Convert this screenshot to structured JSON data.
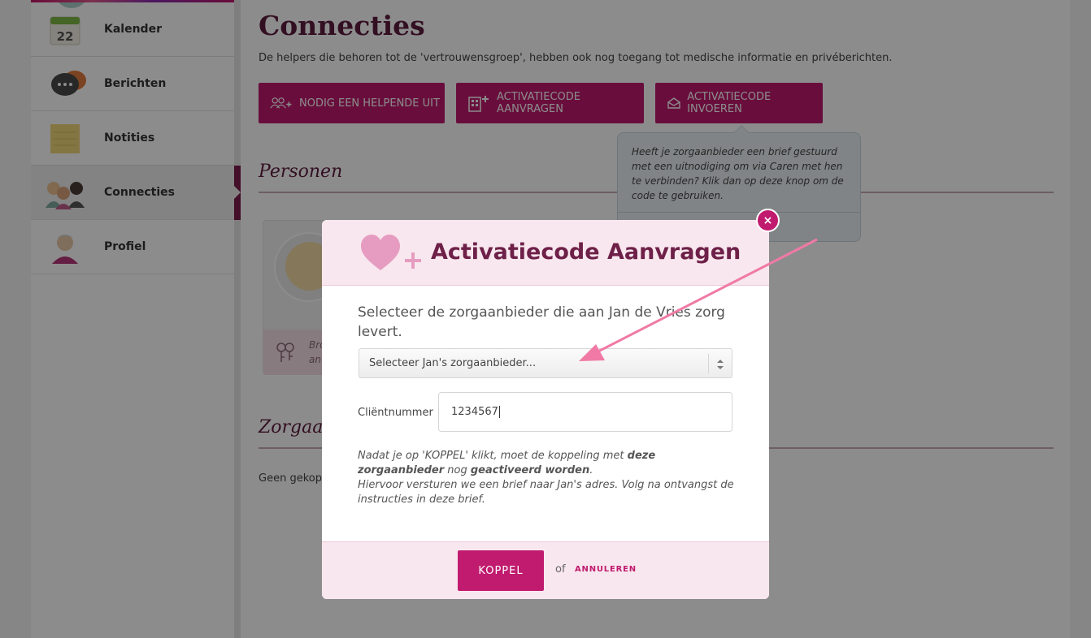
{
  "sidebar": {
    "items": [
      {
        "label": "Kalender",
        "icon": "calendar-icon",
        "badge": "22"
      },
      {
        "label": "Berichten",
        "icon": "chat-bubbles-icon"
      },
      {
        "label": "Notities",
        "icon": "sticky-note-icon"
      },
      {
        "label": "Connecties",
        "icon": "people-icon",
        "active": true
      },
      {
        "label": "Profiel",
        "icon": "profile-avatar-icon"
      }
    ]
  },
  "page": {
    "title": "Connecties",
    "subtitle": "De helpers die behoren tot de 'vertrouwensgroep', hebben ook nog toegang tot medische informatie en privéberichten.",
    "buttons": {
      "nodig": "NODIG EEN HELPENDE UIT",
      "aanvragen": "ACTIVATIECODE AANVRAGEN",
      "invoeren": "ACTIVATIECODE INVOEREN"
    },
    "sections": {
      "personen": "Personen",
      "zorgaanbieders": "Zorgaan"
    },
    "person_card_text": "Bro\nan",
    "geen": "Geen gekopp"
  },
  "tooltip": {
    "text": "Heeft je zorgaanbieder een brief gestuurd met een uitnodiging om via Caren met hen te verbinden? Klik dan op deze knop om de code te gebruiken."
  },
  "modal": {
    "title": "Activatiecode Aanvragen",
    "prompt": "Selecteer de zorgaanbieder die aan Jan de Vries zorg levert.",
    "select_value": "Selecteer Jan's zorgaanbieder...",
    "client_label": "Cliëntnummer",
    "client_value": "1234567",
    "notice": {
      "p1_a": "Nadat je op 'KOPPEL' klikt, moet de koppeling met ",
      "p1_b": "deze zorgaanbieder",
      "p1_c": " nog ",
      "p1_d": "geactiveerd worden",
      "p1_e": ".",
      "p2": "Hiervoor versturen we een brief naar Jan's adres. Volg na ontvangst de instructies in deze brief."
    },
    "submit_label": "KOPPEL",
    "or_text": "of",
    "cancel_label": "ANNULEREN",
    "close_label": "×"
  },
  "colors": {
    "accent": "#c01b6e",
    "title": "#6e2048",
    "annotation_arrow": "#f07aa5"
  }
}
